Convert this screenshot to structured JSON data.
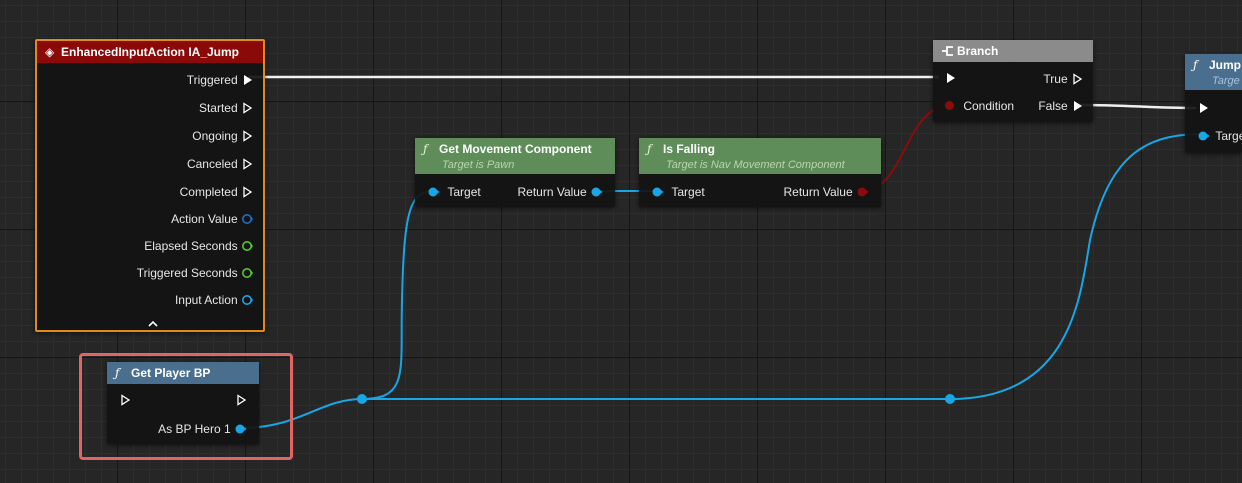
{
  "enhanced_input_node": {
    "title": "EnhancedInputAction IA_Jump",
    "outputs": [
      "Triggered",
      "Started",
      "Ongoing",
      "Canceled",
      "Completed",
      "Action Value",
      "Elapsed Seconds",
      "Triggered Seconds",
      "Input Action"
    ],
    "collapse_icon": "chevron-up-icon"
  },
  "branch_node": {
    "title": "Branch",
    "condition_label": "Condition",
    "true_label": "True",
    "false_label": "False"
  },
  "get_movement_node": {
    "title": "Get Movement Component",
    "subtitle": "Target is Pawn",
    "target_label": "Target",
    "return_label": "Return Value"
  },
  "is_falling_node": {
    "title": "Is Falling",
    "subtitle": "Target is Nav Movement Component",
    "target_label": "Target",
    "return_label": "Return Value"
  },
  "jump_node": {
    "title": "Jump",
    "subtitle": "Targe",
    "target_label": "Targe"
  },
  "get_player_node": {
    "title": "Get Player BP",
    "cast_label": "As BP Hero 1"
  },
  "colors": {
    "event_header": "#8a0a0a",
    "event_border": "#e08a18",
    "pure_header": "#5e8d5a",
    "call_header": "#4a6e8e",
    "branch_header": "#8b8b8b",
    "object_pin": "#19a6e6",
    "bool_pin": "#8c0c0c",
    "float_pin": "#57c82c",
    "struct_pin": "#1f6fbf",
    "selection": "#e06666"
  }
}
